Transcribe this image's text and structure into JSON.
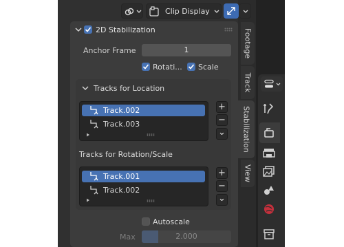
{
  "header": {
    "view_menu_label": "Clip Display",
    "icons": [
      "link-icon",
      "clip-display-icon",
      "gizmo-toggle-icon"
    ]
  },
  "stabilization_panel": {
    "title": "2D Stabilization",
    "enabled": true,
    "anchor_frame_label": "Anchor Frame",
    "anchor_frame_value": "1",
    "rotation_label": "Rotati...",
    "rotation_checked": true,
    "scale_label": "Scale",
    "scale_checked": true
  },
  "location_subpanel": {
    "title": "Tracks for Location",
    "tracks": [
      "Track.002",
      "Track.003"
    ],
    "selected_index": 0
  },
  "rotation_section": {
    "title": "Tracks for Rotation/Scale",
    "tracks": [
      "Track.001",
      "Track.002"
    ],
    "selected_index": 0
  },
  "list_buttons": {
    "add": "+",
    "remove": "−",
    "more": "⌄"
  },
  "autoscale": {
    "label": "Autoscale",
    "checked": false,
    "max_label": "Max",
    "max_value": "2.000"
  },
  "tabs": [
    "Footage",
    "Track",
    "Stabilization",
    "View"
  ],
  "active_tab": "Stabilization",
  "colors": {
    "accent": "#4772b3",
    "panel_bg": "#3c3c3c",
    "sidebar_bg": "#303030"
  }
}
